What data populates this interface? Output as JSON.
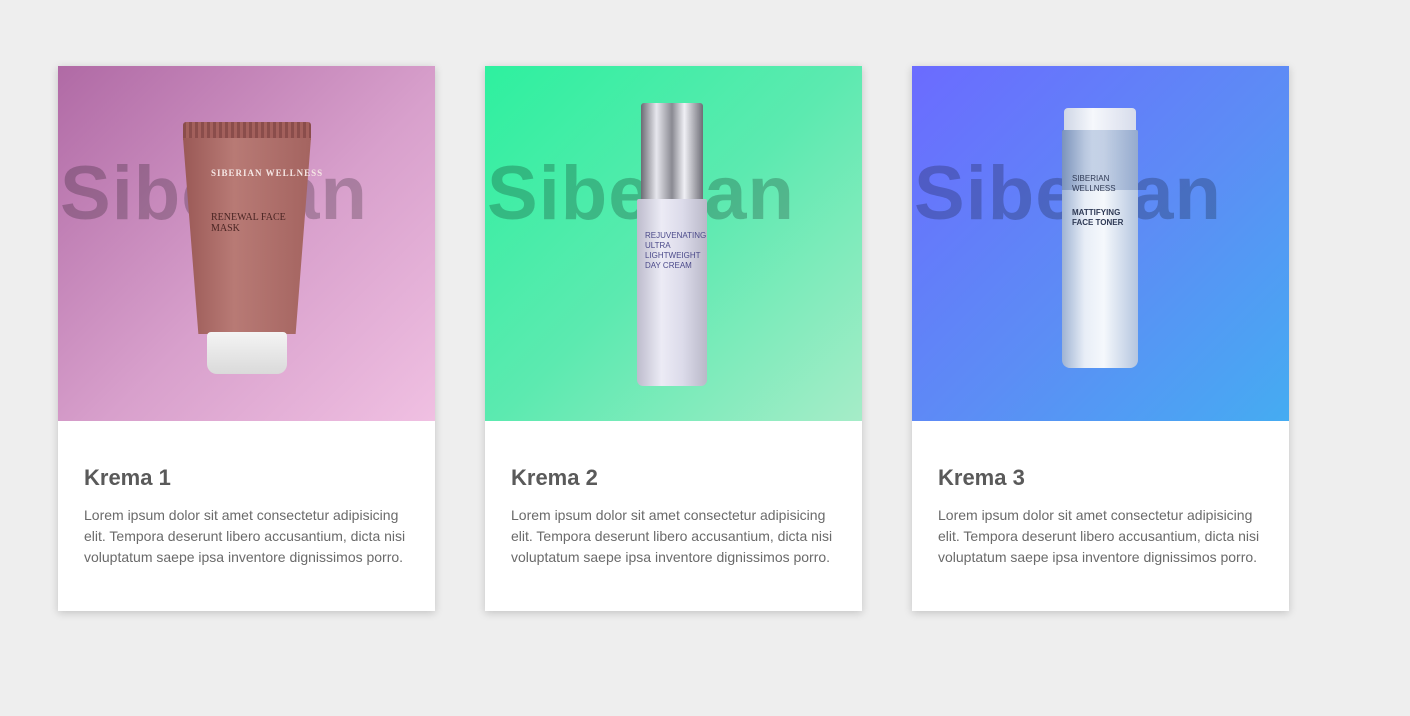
{
  "brand_watermark": "Siberian",
  "cards": [
    {
      "title": "Krema 1",
      "text": "Lorem ipsum dolor sit amet consectetur adipisicing elit. Tempora deserunt libero accusantium, dicta nisi voluptatum saepe ipsa inventore dignissimos porro.",
      "product_brand": "SIBERIAN WELLNESS",
      "product_name": "RENEWAL FACE MASK",
      "accent": "#b06aa5"
    },
    {
      "title": "Krema 2",
      "text": "Lorem ipsum dolor sit amet consectetur adipisicing elit. Tempora deserunt libero accusantium, dicta nisi voluptatum saepe ipsa inventore dignissimos porro.",
      "product_name": "REJUVENATING ULTRA LIGHTWEIGHT DAY CREAM",
      "accent": "#2ef09f"
    },
    {
      "title": "Krema 3",
      "text": "Lorem ipsum dolor sit amet consectetur adipisicing elit. Tempora deserunt libero accusantium, dicta nisi voluptatum saepe ipsa inventore dignissimos porro.",
      "product_brand": "SIBERIAN WELLNESS",
      "product_name": "MATTIFYING FACE TONER",
      "accent": "#6b6bff"
    }
  ]
}
